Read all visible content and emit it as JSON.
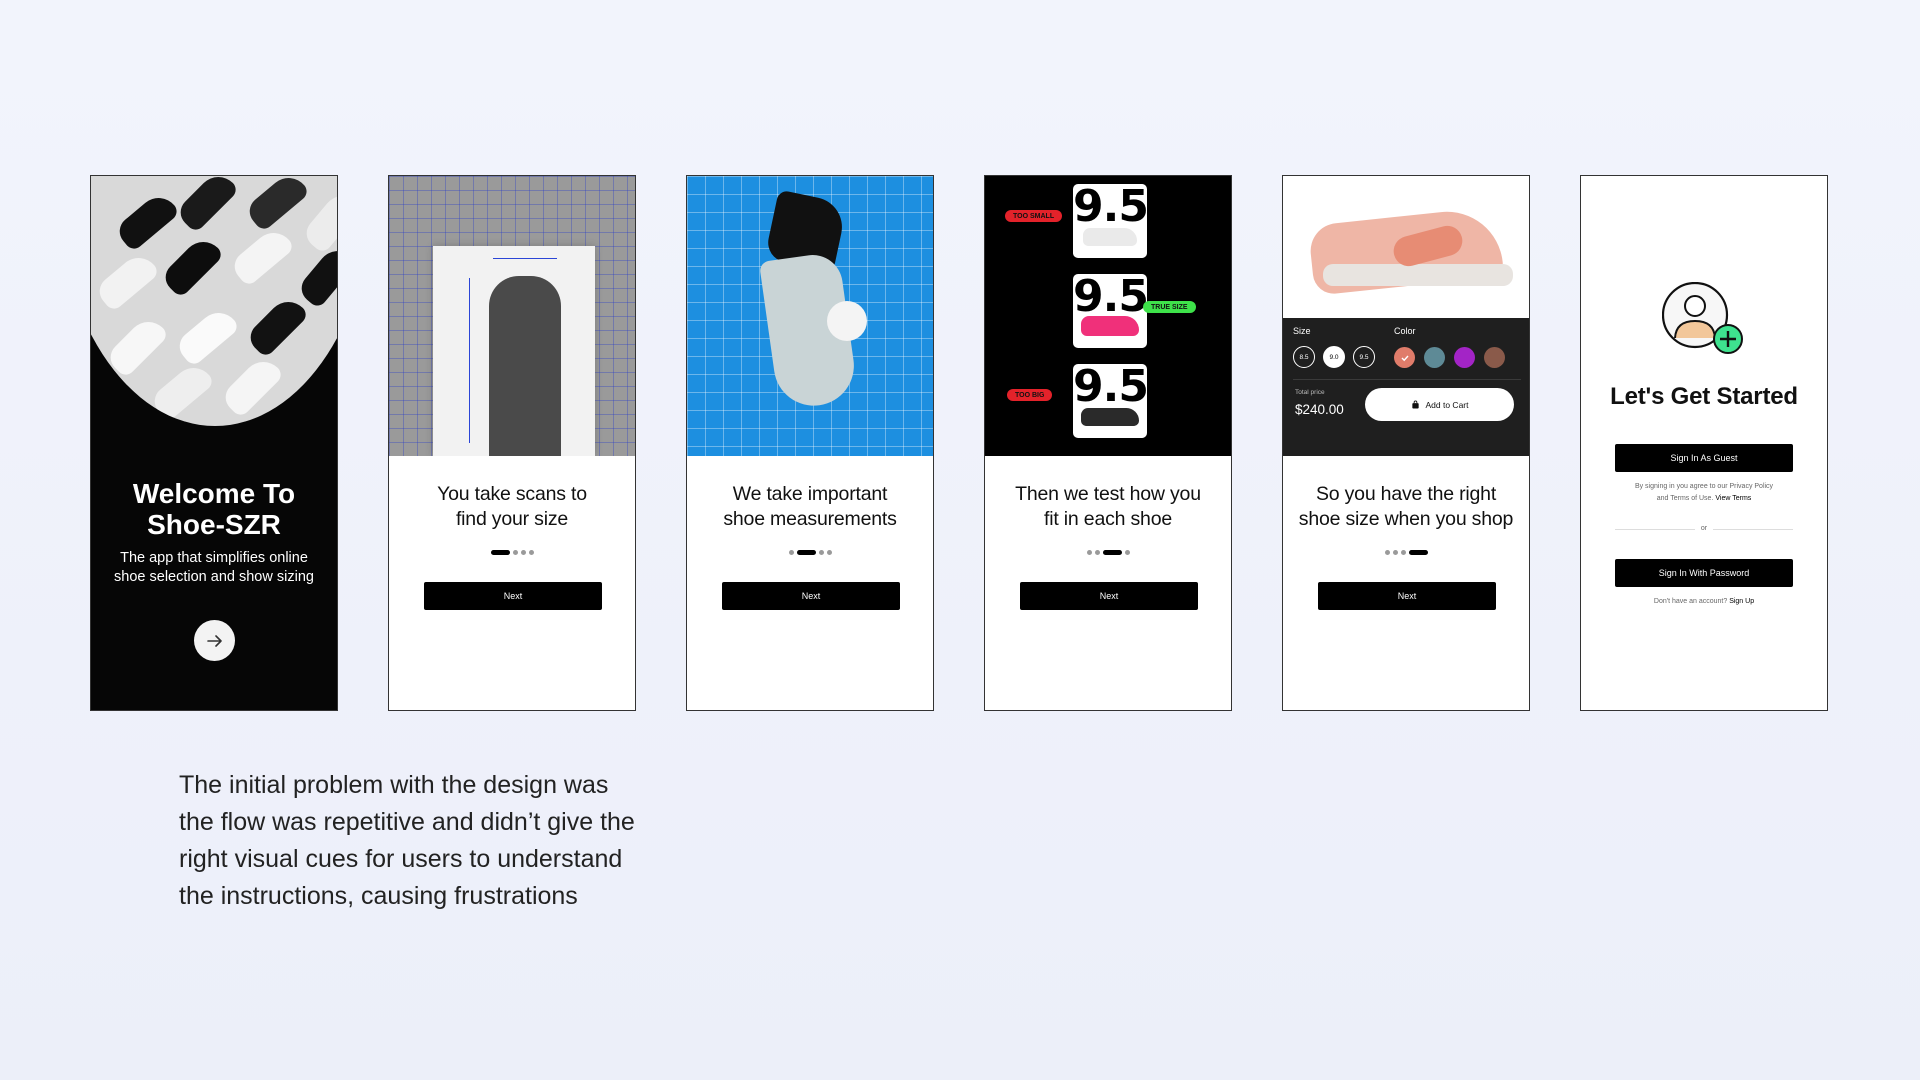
{
  "screens": [
    {
      "id": "welcome",
      "title_line1": "Welcome To",
      "title_line2": "Shoe-SZR",
      "subtitle_line1": "The app that simplifies online",
      "subtitle_line2": "shoe selection and show sizing",
      "arrow_icon": "arrow-right-icon"
    },
    {
      "id": "scan",
      "caption_line1": "You take scans to",
      "caption_line2": "find your size",
      "button": "Next",
      "active_step": 1
    },
    {
      "id": "measure",
      "caption_line1": "We take important",
      "caption_line2": "shoe measurements",
      "button": "Next",
      "active_step": 2
    },
    {
      "id": "fit",
      "size_value": "9.5",
      "tags": [
        "TOO SMALL",
        "TRUE SIZE",
        "TOO BIG"
      ],
      "caption_line1": "Then we test how you",
      "caption_line2": "fit in each shoe",
      "button": "Next",
      "active_step": 3
    },
    {
      "id": "shop",
      "size_label": "Size",
      "sizes": [
        "8.5",
        "9.0",
        "9.5"
      ],
      "color_label": "Color",
      "colors": [
        "#e07c6a",
        "#5e8a96",
        "#a324c6",
        "#8a5a4a"
      ],
      "total_label": "Total price",
      "total_value": "$240.00",
      "cart_button": "Add to Cart",
      "caption_line1": "So you have the right",
      "caption_line2": "shoe size when you shop",
      "button": "Next",
      "active_step": 4
    },
    {
      "id": "get-started",
      "title": "Let's Get Started",
      "guest_button": "Sign In As Guest",
      "terms_line1": "By signing in you agree to our Privacy Policy",
      "terms_line2": "and Terms of Use.",
      "terms_link": "View Terms",
      "or_text": "or",
      "password_button": "Sign In With Password",
      "no_account_text": "Don't have an account?",
      "signup_link": "Sign Up"
    }
  ],
  "description": [
    "The initial problem with the design was",
    "the flow was repetitive and didn’t give the",
    "right visual cues for users to understand",
    "the instructions, causing frustrations"
  ],
  "colors": {
    "background": "#eef1fa",
    "black": "#000000",
    "true_size_tag": "#3ee24a",
    "wrong_size_tag": "#e3222a"
  }
}
